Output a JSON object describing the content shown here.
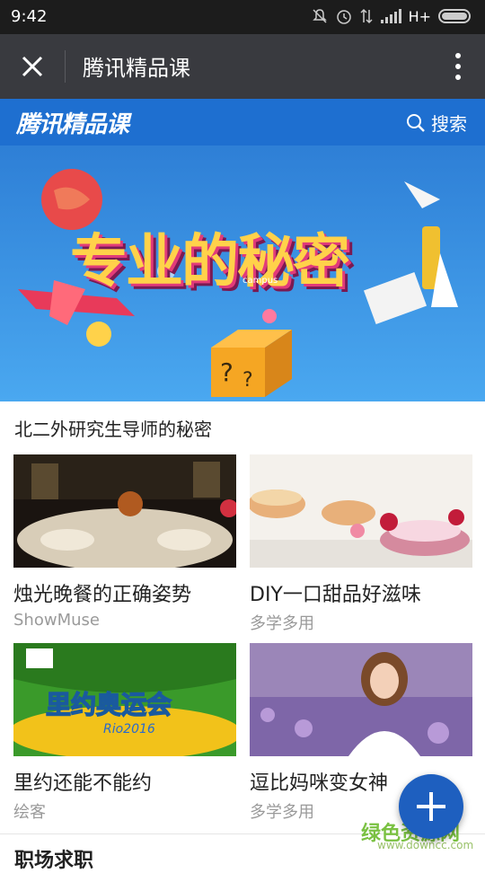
{
  "status_bar": {
    "time": "9:42",
    "network": "H+"
  },
  "title_bar": {
    "title": "腾讯精品课"
  },
  "brand_bar": {
    "logo_text": "腾讯精品课",
    "search_label": "搜索"
  },
  "banner": {
    "headline": "专业的秘密",
    "badge": "campus"
  },
  "section": {
    "title": "北二外研究生导师的秘密"
  },
  "courses": [
    {
      "title": "烛光晚餐的正确姿势",
      "source": "ShowMuse"
    },
    {
      "title": "DIY一口甜品好滋味",
      "source": "多学多用"
    },
    {
      "title": "里约还能不能约",
      "source": "绘客"
    },
    {
      "title": "逗比妈咪变女神",
      "source": "多学多用"
    }
  ],
  "thumb_texts": {
    "rio_title": "里约奥运会",
    "rio_sub": "Rio2016"
  },
  "next_section": {
    "title": "职场求职"
  },
  "watermark": {
    "text": "绿色资源网",
    "url": "www.downcc.com"
  },
  "colors": {
    "titlebar": "#393a3f",
    "brand_blue": "#1e6fd0",
    "fab": "#1e5fbf"
  },
  "icons": [
    "close-icon",
    "more-vert-icon",
    "search-icon",
    "plus-icon",
    "wifi-signal-icon",
    "alarm-icon",
    "battery-icon"
  ]
}
